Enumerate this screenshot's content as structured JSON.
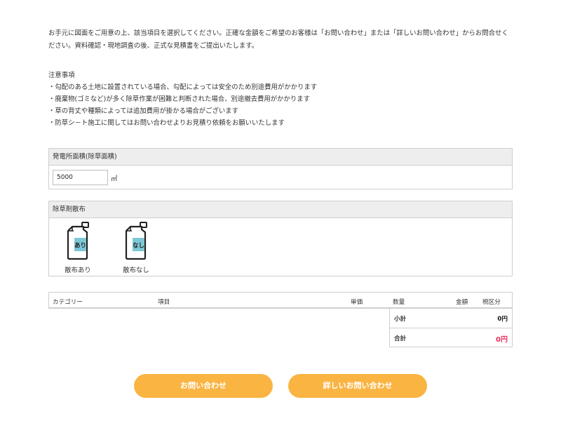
{
  "intro": {
    "text": "お手元に図面をご用意の上、該当項目を選択してください。正確な金額をご希望のお客様は「お問い合わせ」または「詳しいお問い合わせ」からお問合せください。資料確認・現地調査の後、正式な見積書をご提出いたします。"
  },
  "notes": {
    "title": "注意事項",
    "items": [
      "・勾配のある土地に設置されている場合、勾配によっては安全のため別途費用がかかります",
      "・廃棄物(ゴミなど)が多く除草作業が困難と判断された場合、別途撤去費用がかかります",
      "・草の背丈や種類によっては追加費用が掛かる場合がございます",
      "・防草シ－ト施工に関してはお問い合わせよりお見積り依頼をお願いいたします"
    ]
  },
  "area": {
    "label": "発電所面積(除草面積)",
    "value": "5000",
    "unit": "㎡"
  },
  "herbicide": {
    "label": "除草剤散布",
    "options": [
      {
        "icon_text": "あり",
        "label": "散布あり",
        "icon": "herbicide-bottle-icon"
      },
      {
        "icon_text": "なし",
        "label": "散布なし",
        "icon": "herbicide-bottle-icon"
      }
    ]
  },
  "estimate": {
    "headers": {
      "category": "カテゴリー",
      "item": "項目",
      "unit_price": "単価",
      "quantity": "数量",
      "amount": "金額",
      "tax": "税区分"
    },
    "subtotal_label": "小計",
    "subtotal_value": "0円",
    "total_label": "合計",
    "total_value": "0円"
  },
  "buttons": {
    "contact": "お問い合わせ",
    "detail_contact": "詳しいお問い合わせ"
  },
  "colors": {
    "button": "#fab442",
    "total_value": "#e8305a",
    "bottle_label": "#7cc8d6",
    "panel_header": "#eeeeee"
  }
}
